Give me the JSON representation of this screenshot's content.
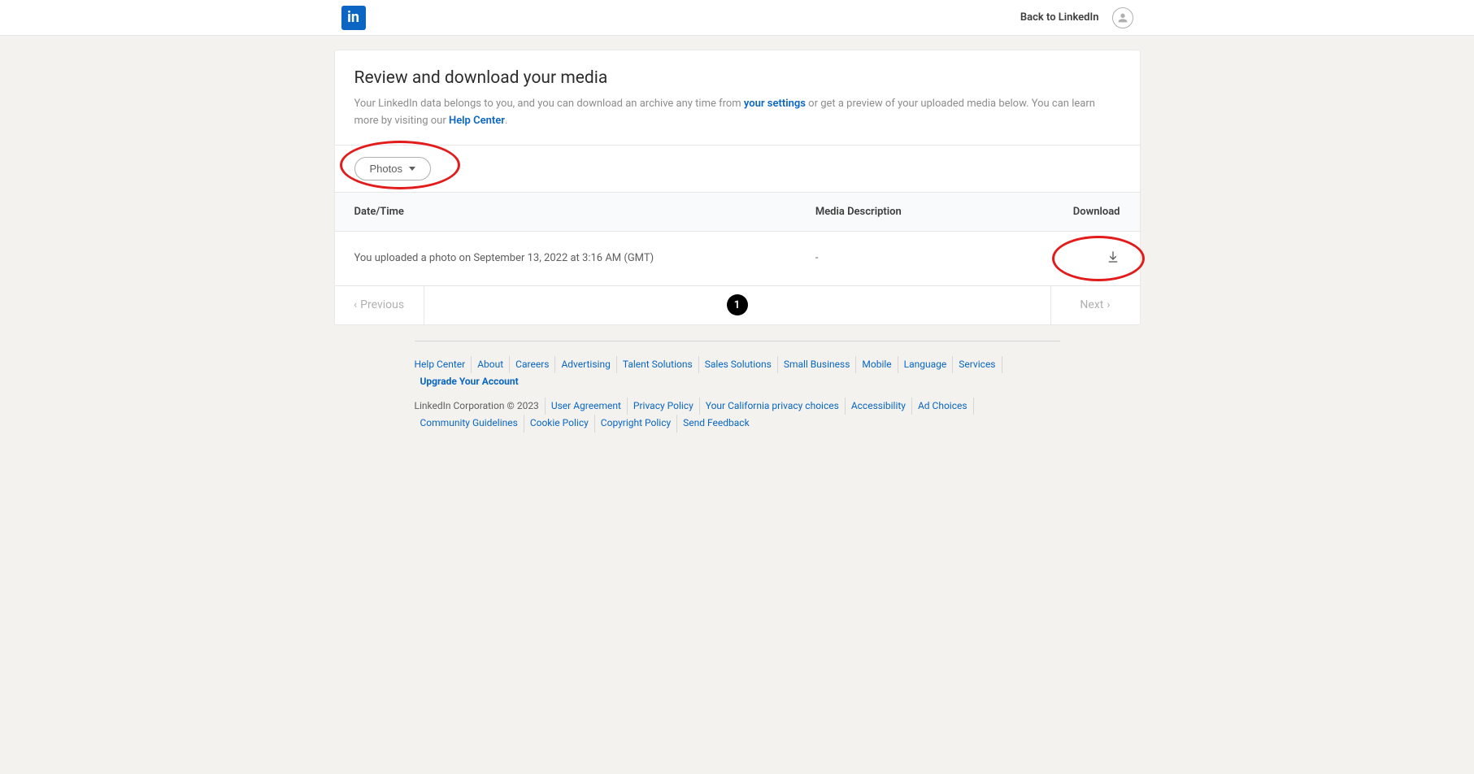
{
  "header": {
    "back_label": "Back to LinkedIn"
  },
  "page": {
    "title": "Review and download your media",
    "desc_prefix": "Your LinkedIn data belongs to you, and you can download an archive any time from ",
    "desc_link1": "your settings",
    "desc_mid": " or get a preview of your uploaded media below. You can learn more by visiting our ",
    "desc_link2": "Help Center",
    "desc_suffix": "."
  },
  "filter": {
    "label": "Photos"
  },
  "table": {
    "columns": {
      "date": "Date/Time",
      "desc": "Media Description",
      "download": "Download"
    },
    "rows": [
      {
        "date": "You uploaded a photo on September 13, 2022 at 3:16 AM (GMT)",
        "desc": "-"
      }
    ]
  },
  "pagination": {
    "prev": "Previous",
    "next": "Next",
    "current": "1"
  },
  "footer": {
    "links1": [
      "Help Center",
      "About",
      "Careers",
      "Advertising",
      "Talent Solutions",
      "Sales Solutions",
      "Small Business",
      "Mobile",
      "Language",
      "Services",
      "Upgrade Your Account"
    ],
    "copyright": "LinkedIn Corporation © 2023",
    "links2": [
      "User Agreement",
      "Privacy Policy",
      "Your California privacy choices",
      "Accessibility",
      "Ad Choices",
      "Community Guidelines",
      "Cookie Policy",
      "Copyright Policy",
      "Send Feedback"
    ]
  }
}
